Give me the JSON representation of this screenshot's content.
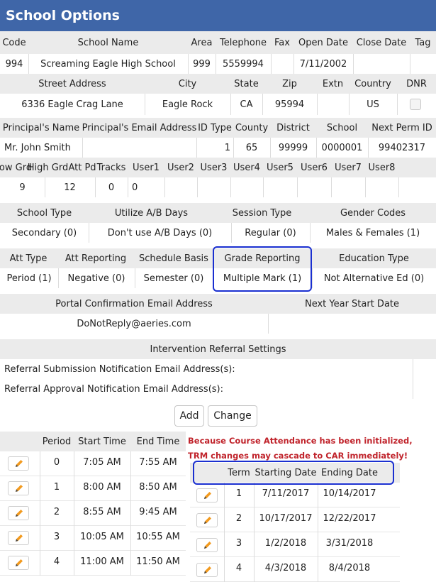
{
  "title": "School Options",
  "icons": {
    "edit": "pencil-icon"
  },
  "colors": {
    "header": "#3f66a8",
    "highlight": "#1a2fd0",
    "warning": "#c0232b",
    "pencil": "#f29a1e"
  },
  "school_info": {
    "headers": [
      "Code",
      "School Name",
      "Area",
      "Telephone",
      "Fax",
      "Open Date",
      "Close Date",
      "Tag"
    ],
    "values": [
      "994",
      "Screaming Eagle High School",
      "999",
      "5559994",
      "",
      "7/11/2002",
      "",
      ""
    ]
  },
  "address": {
    "headers": [
      "Street Address",
      "City",
      "State",
      "Zip",
      "Extn",
      "Country",
      "DNR"
    ],
    "values": [
      "6336 Eagle Crag Lane",
      "Eagle Rock",
      "CA",
      "95994",
      "",
      "US"
    ]
  },
  "principal": {
    "headers": [
      "Principal's Name",
      "Principal's Email Address",
      "ID Type",
      "County",
      "District",
      "School",
      "Next Perm ID"
    ],
    "values": [
      "Mr. John Smith",
      "",
      "1",
      "65",
      "99999",
      "0000001",
      "99402317"
    ]
  },
  "grades": {
    "headers": [
      "Low Grd",
      "High Grd",
      "Att Pd",
      "Tracks",
      "User1",
      "User2",
      "User3",
      "User4",
      "User5",
      "User6",
      "User7",
      "User8"
    ],
    "values": [
      "9",
      "12",
      "0",
      "0",
      "",
      "",
      "",
      "",
      "",
      "",
      "",
      ""
    ]
  },
  "school_type": {
    "headers": [
      "School Type",
      "Utilize A/B Days",
      "Session Type",
      "Gender Codes"
    ],
    "values": [
      "Secondary (0)",
      "Don't use A/B Days (0)",
      "Regular (0)",
      "Males & Females (1)"
    ]
  },
  "attendance": {
    "headers": [
      "Att Type",
      "Att Reporting",
      "Schedule Basis",
      "Grade Reporting",
      "Education Type"
    ],
    "values": [
      "Period (1)",
      "Negative (0)",
      "Semester (0)",
      "Multiple Mark (1)",
      "Not Alternative Ed (0)"
    ]
  },
  "portal": {
    "headers": [
      "Portal Confirmation Email Address",
      "Next Year Start Date"
    ],
    "values": [
      "DoNotReply@aeries.com",
      ""
    ]
  },
  "intervention": {
    "title": "Intervention Referral Settings",
    "rows": [
      "Referral Submission Notification Email Address(s):",
      "Referral Approval Notification Email Address(s):"
    ]
  },
  "buttons": {
    "add": "Add",
    "change": "Change"
  },
  "warning": [
    "Because Course Attendance has been initialized,",
    "TRM changes may cascade to CAR immediately!"
  ],
  "periods": {
    "headers": [
      "",
      "Period",
      "Start Time",
      "End Time"
    ],
    "rows": [
      [
        "0",
        "7:05 AM",
        "7:55 AM"
      ],
      [
        "1",
        "8:00 AM",
        "8:50 AM"
      ],
      [
        "2",
        "8:55 AM",
        "9:45 AM"
      ],
      [
        "3",
        "10:05 AM",
        "10:55 AM"
      ],
      [
        "4",
        "11:00 AM",
        "11:50 AM"
      ]
    ]
  },
  "terms": {
    "headers": [
      "",
      "Term",
      "Starting Date",
      "Ending Date"
    ],
    "rows": [
      [
        "1",
        "7/11/2017",
        "10/14/2017"
      ],
      [
        "2",
        "10/17/2017",
        "12/22/2017"
      ],
      [
        "3",
        "1/2/2018",
        "3/31/2018"
      ],
      [
        "4",
        "4/3/2018",
        "8/4/2018"
      ]
    ]
  }
}
